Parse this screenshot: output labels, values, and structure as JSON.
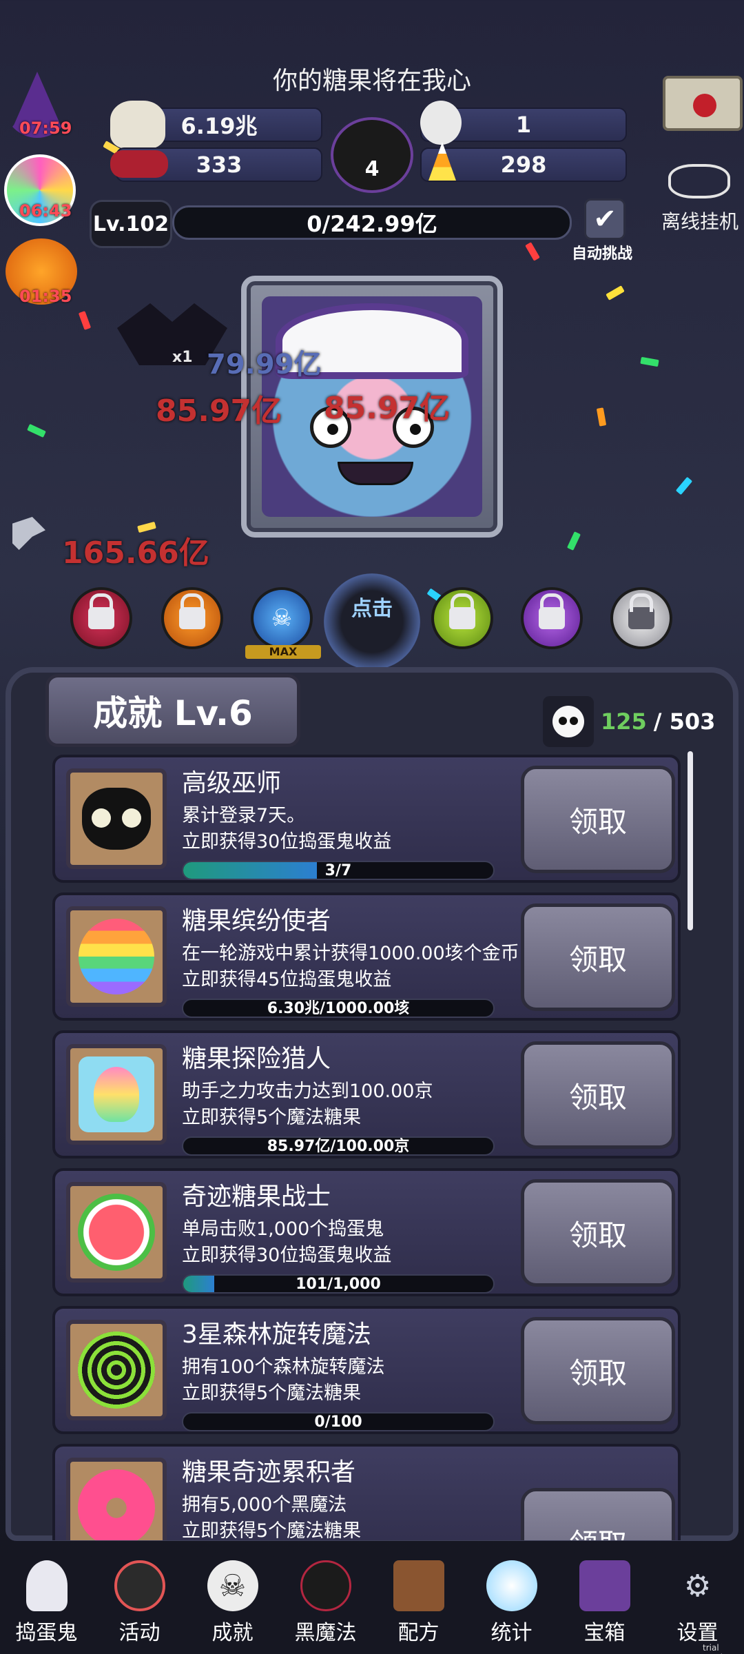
{
  "header": {
    "title": "你的糖果将在我心",
    "timers": [
      "07:59",
      "06:43",
      "01:35"
    ],
    "stat_candy": "6.19兆",
    "stat_skull": "1",
    "stat_eyes": "333",
    "stat_corn": "298",
    "cauldron_count": "4",
    "level": "Lv.102",
    "level_progress": "0/242.99亿",
    "auto_challenge_label": "自动挑战",
    "offline_label": "离线挂机"
  },
  "battle": {
    "damage_numbers": [
      "79.99亿",
      "85.97亿",
      "85.97亿",
      "165.66亿"
    ],
    "tap_label": "点击",
    "max_label": "MAX",
    "multiplier": "x1"
  },
  "achievements": {
    "header": "成就 Lv.6",
    "count_current": "125",
    "count_total": "/ 503",
    "items": [
      {
        "title": "高级巫师",
        "desc": "累计登录7天。",
        "reward": "立即获得30位捣蛋鬼收益",
        "progress_text": "3/7",
        "progress": 0.43,
        "button": "领取"
      },
      {
        "title": "糖果缤纷使者",
        "desc": "在一轮游戏中累计获得1000.00垓个金币",
        "reward": "立即获得45位捣蛋鬼收益",
        "progress_text": "6.30兆/1000.00垓",
        "progress": 0.0,
        "button": "领取"
      },
      {
        "title": "糖果探险猎人",
        "desc": "助手之力攻击力达到100.00京",
        "reward": "立即获得5个魔法糖果",
        "progress_text": "85.97亿/100.00京",
        "progress": 0.0,
        "button": "领取"
      },
      {
        "title": "奇迹糖果战士",
        "desc": "单局击败1,000个捣蛋鬼",
        "reward": "立即获得30位捣蛋鬼收益",
        "progress_text": "101/1,000",
        "progress": 0.1,
        "button": "领取"
      },
      {
        "title": "3星森林旋转魔法",
        "desc": "拥有100个森林旋转魔法",
        "reward": "立即获得5个魔法糖果",
        "progress_text": "0/100",
        "progress": 0.0,
        "button": "领取"
      },
      {
        "title": "糖果奇迹累积者",
        "desc": "拥有5,000个黑魔法",
        "reward": "立即获得5个魔法糖果",
        "progress_text": "",
        "progress": 0.0,
        "button": "领取"
      }
    ]
  },
  "nav": {
    "items": [
      {
        "label": "捣蛋鬼",
        "icon": "ghost-icon"
      },
      {
        "label": "活动",
        "icon": "eyeball-cauldron-icon"
      },
      {
        "label": "成就",
        "icon": "skull-icon"
      },
      {
        "label": "黑魔法",
        "icon": "demon-icon"
      },
      {
        "label": "配方",
        "icon": "spellbook-icon"
      },
      {
        "label": "统计",
        "icon": "crystal-ball-icon"
      },
      {
        "label": "宝箱",
        "icon": "treasure-chest-icon"
      },
      {
        "label": "设置",
        "icon": "gear-icon"
      }
    ]
  },
  "footer": {
    "trial": "trial version"
  },
  "colors": {
    "accent_green": "#6fce5f",
    "damage_red": "#c43131",
    "progress_blue": "#2c7fd1"
  }
}
